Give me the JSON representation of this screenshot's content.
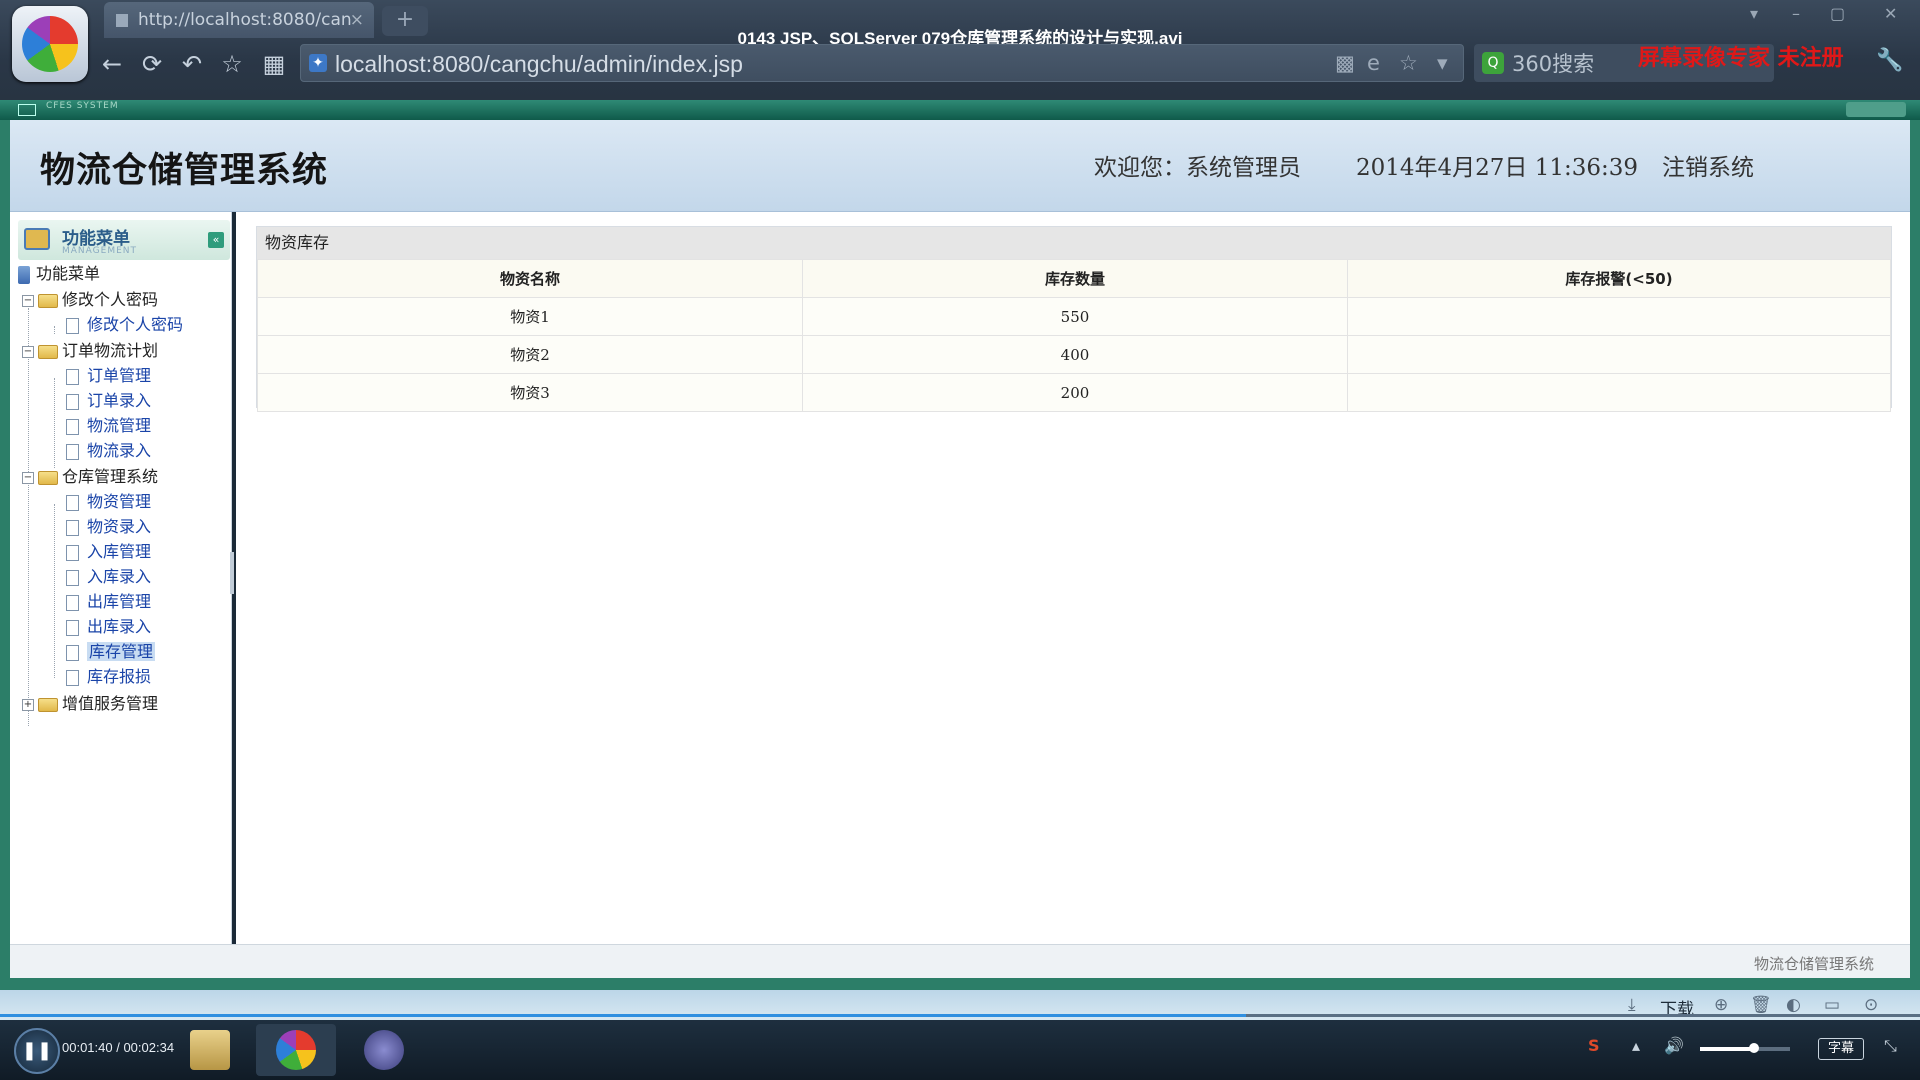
{
  "browser": {
    "tab_title": "http://localhost:8080/can",
    "tab_close": "×",
    "new_tab": "+",
    "url": "localhost:8080/cangchu/admin/index.jsp",
    "search_text": "360搜索",
    "nav": {
      "back": "←",
      "reload": "⟳",
      "undo": "↶",
      "favorite": "☆",
      "apps": "▦"
    }
  },
  "video": {
    "title": "0143 JSP、SQLServer 079仓库管理系统的设计与实现.avi",
    "watermark": "屏幕录像专家 未注册",
    "time": "00:01:40 / 00:02:34",
    "progress": 0.649,
    "volume": 0.6,
    "download_label": "下载",
    "subtitle_label": "字幕",
    "pause_symbol": "❚❚"
  },
  "frame": {
    "brand": "CFES SYSTEM"
  },
  "header": {
    "title": "物流仓储管理系统",
    "welcome": "欢迎您：系统管理员",
    "datetime": "2014年4月27日 11:36:39",
    "logout": "注销系统"
  },
  "sidebar": {
    "head_title": "功能菜单",
    "head_sub": "MANAGEMENT",
    "root": "功能菜单",
    "groups": [
      {
        "label": "修改个人密码",
        "expanded": true,
        "items": [
          "修改个人密码"
        ]
      },
      {
        "label": "订单物流计划",
        "expanded": true,
        "items": [
          "订单管理",
          "订单录入",
          "物流管理",
          "物流录入"
        ]
      },
      {
        "label": "仓库管理系统",
        "expanded": true,
        "items": [
          "物资管理",
          "物资录入",
          "入库管理",
          "入库录入",
          "出库管理",
          "出库录入",
          "库存管理",
          "库存报损"
        ]
      },
      {
        "label": "增值服务管理",
        "expanded": false,
        "items": []
      }
    ],
    "selected": "库存管理"
  },
  "main": {
    "panel_title": "物资库存",
    "columns": [
      "物资名称",
      "库存数量",
      "库存报警(<50)"
    ],
    "rows": [
      [
        "物资1",
        "550",
        ""
      ],
      [
        "物资2",
        "400",
        ""
      ],
      [
        "物资3",
        "200",
        ""
      ]
    ]
  },
  "statusbar": {
    "text": "物流仓储管理系统"
  }
}
